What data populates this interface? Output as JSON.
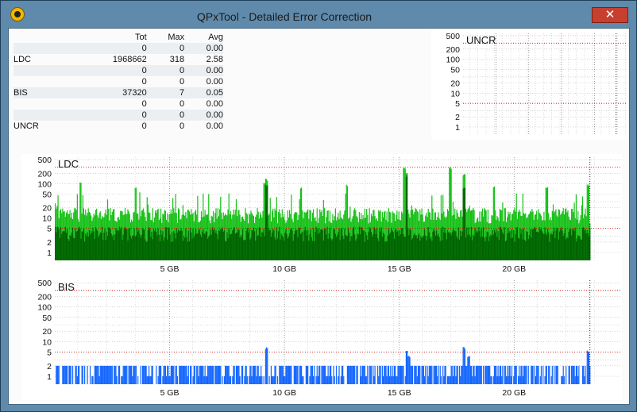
{
  "window": {
    "title": "QPxTool - Detailed Error Correction",
    "close_glyph": "✕",
    "app_icon": "qpxtool-logo-icon"
  },
  "stats": {
    "headers": [
      "",
      "Tot",
      "Max",
      "Avg"
    ],
    "rows": [
      [
        "",
        "0",
        "0",
        "0.00"
      ],
      [
        "LDC",
        "1968662",
        "318",
        "2.58"
      ],
      [
        "",
        "0",
        "0",
        "0.00"
      ],
      [
        "",
        "0",
        "0",
        "0.00"
      ],
      [
        "BIS",
        "37320",
        "7",
        "0.05"
      ],
      [
        "",
        "0",
        "0",
        "0.00"
      ],
      [
        "",
        "0",
        "0",
        "0.00"
      ],
      [
        "UNCR",
        "0",
        "0",
        "0.00"
      ]
    ]
  },
  "colors": {
    "ldc_light": "#18c018",
    "ldc_dark": "#006400",
    "bis": "#1466ff",
    "threshold": "#cc0000"
  },
  "chart_data": [
    {
      "type": "bar",
      "title": "UNCR",
      "yscale": "log",
      "yticks": [
        "500",
        "200",
        "100",
        "50",
        "20",
        "10",
        "5",
        "2",
        "1"
      ],
      "xticks": [
        "5 GB",
        "10 GB",
        "15 GB",
        "20 GB"
      ],
      "xtick_values": [
        5,
        10,
        15,
        20
      ],
      "xlim": [
        0,
        24.9
      ],
      "end": 23.3,
      "thresholds": [
        5,
        300
      ],
      "series": [
        {
          "values": []
        }
      ]
    },
    {
      "type": "bar",
      "title": "LDC",
      "yscale": "log",
      "yticks": [
        "500",
        "200",
        "100",
        "50",
        "20",
        "10",
        "5",
        "2",
        "1"
      ],
      "xticks": [
        "5 GB",
        "10 GB",
        "15 GB",
        "20 GB"
      ],
      "xtick_values": [
        5,
        10,
        15,
        20
      ],
      "xlim": [
        0,
        24.9
      ],
      "end": 23.3,
      "thresholds": [
        5,
        300
      ],
      "series": [
        {
          "baseline": 14,
          "peaks": [
            [
              1.1,
              120
            ],
            [
              3.5,
              80
            ],
            [
              9.1,
              110
            ],
            [
              9.2,
              140
            ],
            [
              10.7,
              80
            ],
            [
              12.7,
              100
            ],
            [
              15.2,
              300
            ],
            [
              15.3,
              220
            ],
            [
              17.2,
              300
            ],
            [
              17.8,
              200
            ],
            [
              19.1,
              90
            ],
            [
              21.4,
              80
            ],
            [
              23.2,
              100
            ]
          ]
        },
        {
          "baseline": 4,
          "peaks": [
            [
              9.2,
              100
            ],
            [
              15.3,
              180
            ],
            [
              17.8,
              80
            ]
          ]
        }
      ]
    },
    {
      "type": "bar",
      "title": "BIS",
      "yscale": "log",
      "yticks": [
        "500",
        "200",
        "100",
        "50",
        "20",
        "10",
        "5",
        "2",
        "1"
      ],
      "xticks": [
        "5 GB",
        "10 GB",
        "15 GB",
        "20 GB"
      ],
      "xtick_values": [
        5,
        10,
        15,
        20
      ],
      "xlim": [
        0,
        24.9
      ],
      "end": 23.3,
      "thresholds": [
        5,
        300
      ],
      "series": [
        {
          "baseline": 2,
          "peaks": [
            [
              9.2,
              7
            ],
            [
              15.3,
              6
            ],
            [
              15.4,
              4
            ],
            [
              17.8,
              7
            ],
            [
              18.0,
              4
            ],
            [
              23.2,
              6
            ]
          ]
        }
      ]
    }
  ]
}
